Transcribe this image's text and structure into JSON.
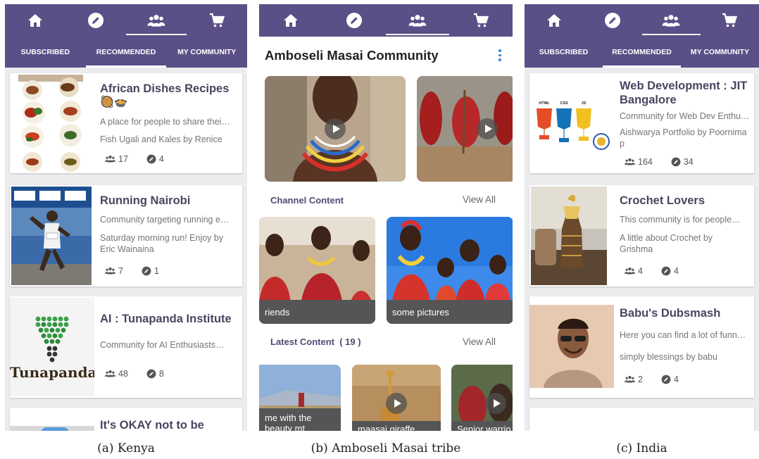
{
  "captions": [
    "(a) Kenya",
    "(b) Amboseli Masai tribe",
    "(c) India"
  ],
  "tabs": [
    "SUBSCRIBED",
    "RECOMMENDED",
    "MY COMMUNITY"
  ],
  "colors": {
    "primary": "#5b4f87",
    "accent": "#3f87d8"
  },
  "icons": [
    "home-icon",
    "pencil-icon",
    "group-icon",
    "cart-icon"
  ],
  "kenya": [
    {
      "title": "African Dishes Recipes",
      "emoji": "🥘🍲",
      "desc": "A place for people to share thei…",
      "by": "Fish Ugali and Kales by Renice",
      "members": "17",
      "posts": "4"
    },
    {
      "title": "Running Nairobi",
      "desc": "Community targeting running e…",
      "by": "Saturday morning run! Enjoy by Eric Wainaina",
      "members": "7",
      "posts": "1"
    },
    {
      "title": "AI : Tunapanda Institute",
      "desc": "Community for AI Enthusiasts…",
      "members": "48",
      "posts": "8",
      "logo_text": "Tunapanda"
    },
    {
      "title": "It's OKAY not to be OKAY."
    }
  ],
  "masai": {
    "title": "Amboseli Masai Community",
    "channel_label": "Channel Content",
    "view_all": "View All",
    "channel_items": [
      "riends",
      "some pictures"
    ],
    "latest_label": "Latest Content",
    "latest_count": "( 19 )",
    "latest_items": [
      "me with the beauty mt",
      "maasai giraffe",
      "Senior warrio"
    ]
  },
  "india": [
    {
      "title": "Web Development : JIT Bangalore",
      "desc": "Community for Web Dev Enthu…",
      "by": "Aishwarya Portfolio by Poornima p",
      "members": "164",
      "posts": "34",
      "badges": [
        "HTML",
        "CSS",
        "JS"
      ]
    },
    {
      "title": "Crochet Lovers",
      "desc": "This community is for people…",
      "by": "A little about Crochet by Grishma",
      "members": "4",
      "posts": "4"
    },
    {
      "title": "Babu's Dubsmash",
      "desc": "Here you can find a lot of funny…",
      "by": "simply blessings by babu",
      "members": "2",
      "posts": "4"
    }
  ]
}
